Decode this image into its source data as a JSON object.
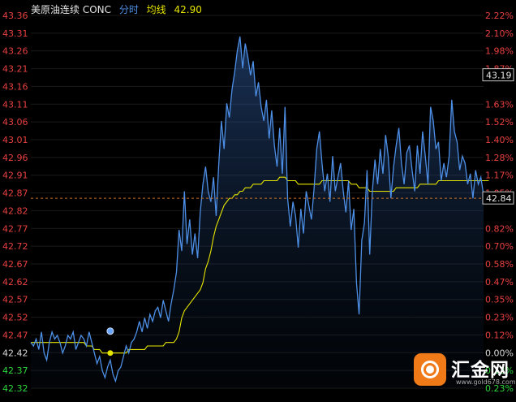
{
  "header": {
    "name": "美原油连续 CONC",
    "mode": "分时",
    "avg_label": "均线",
    "price": "42.90"
  },
  "logo": {
    "text": "汇金网",
    "url": "www.gold678.com"
  },
  "colors": {
    "background": "#000000",
    "price_line": "#4d8fe6",
    "avg_line": "#e6e600",
    "up": "#e84040",
    "down": "#2dd63c",
    "prev_close_line": "#d07020"
  },
  "chart_data": {
    "type": "line",
    "ylim": [
      42.3,
      43.36
    ],
    "prev_close": 42.42,
    "y_ticks_left": [
      "43.36",
      "43.31",
      "43.26",
      "43.21",
      "43.16",
      "43.11",
      "43.06",
      "43.01",
      "42.96",
      "42.91",
      "42.87",
      "42.82",
      "42.77",
      "42.72",
      "42.67",
      "42.62",
      "42.57",
      "42.52",
      "42.47",
      "42.42",
      "42.37",
      "42.32"
    ],
    "y_ticks_right": [
      "2.22%",
      "2.10%",
      "1.98%",
      "1.87%",
      "",
      "1.63%",
      "1.52%",
      "1.40%",
      "1.28%",
      "1.17%",
      "1.05%",
      "",
      "0.82%",
      "0.70%",
      "0.58%",
      "0.47%",
      "0.35%",
      "0.23%",
      "0.12%",
      "0.00%",
      "0.12%",
      "0.23%"
    ],
    "right_markers": [
      {
        "value": 43.19,
        "label": "43.19"
      },
      {
        "value": 42.84,
        "label": "42.84"
      }
    ],
    "dashed_reference": 42.84,
    "current_marker": {
      "value": 42.43,
      "index": 30
    },
    "series": [
      {
        "kind": "price",
        "values": [
          42.43,
          42.42,
          42.44,
          42.41,
          42.46,
          42.4,
          42.38,
          42.43,
          42.46,
          42.44,
          42.45,
          42.43,
          42.4,
          42.42,
          42.45,
          42.44,
          42.46,
          42.41,
          42.43,
          42.45,
          42.44,
          42.42,
          42.46,
          42.43,
          42.4,
          42.37,
          42.39,
          42.35,
          42.33,
          42.36,
          42.38,
          42.34,
          42.32,
          42.35,
          42.36,
          42.39,
          42.42,
          42.4,
          42.43,
          42.44,
          42.46,
          42.49,
          42.46,
          42.5,
          42.47,
          42.51,
          42.49,
          42.52,
          42.53,
          42.5,
          42.55,
          42.52,
          42.49,
          42.54,
          42.58,
          42.63,
          42.75,
          42.69,
          42.86,
          42.71,
          42.78,
          42.68,
          42.74,
          42.67,
          42.8,
          42.88,
          42.93,
          42.86,
          42.83,
          42.9,
          42.79,
          42.94,
          43.06,
          42.98,
          43.11,
          43.07,
          43.15,
          43.2,
          43.26,
          43.3,
          43.21,
          43.28,
          43.24,
          43.19,
          43.23,
          43.13,
          43.17,
          43.1,
          43.06,
          43.12,
          43.01,
          43.09,
          42.99,
          42.93,
          43.04,
          42.91,
          43.1,
          42.84,
          42.76,
          42.83,
          42.79,
          42.7,
          42.81,
          42.74,
          42.86,
          42.82,
          42.78,
          42.87,
          42.98,
          43.03,
          42.94,
          42.86,
          42.91,
          42.83,
          42.96,
          42.86,
          42.9,
          42.94,
          42.86,
          42.8,
          42.89,
          42.75,
          42.81,
          42.6,
          42.51,
          42.72,
          42.77,
          42.92,
          42.68,
          42.86,
          42.95,
          42.88,
          42.98,
          42.91,
          43.02,
          42.96,
          42.84,
          42.93,
          42.99,
          43.04,
          42.94,
          42.88,
          42.97,
          42.99,
          42.92,
          42.86,
          42.99,
          42.91,
          43.03,
          42.96,
          42.88,
          43.1,
          43.06,
          42.98,
          43.0,
          42.89,
          42.94,
          42.9,
          42.96,
          43.12,
          43.03,
          43.0,
          42.92,
          42.96,
          42.94,
          42.88,
          42.91,
          42.84,
          42.92,
          42.88,
          42.9,
          42.85
        ]
      },
      {
        "kind": "average",
        "values": [
          42.43,
          42.43,
          42.43,
          42.43,
          42.43,
          42.43,
          42.43,
          42.43,
          42.43,
          42.43,
          42.43,
          42.43,
          42.43,
          42.43,
          42.43,
          42.43,
          42.43,
          42.43,
          42.43,
          42.43,
          42.43,
          42.42,
          42.42,
          42.42,
          42.41,
          42.41,
          42.41,
          42.4,
          42.4,
          42.4,
          42.4,
          42.4,
          42.4,
          42.4,
          42.4,
          42.4,
          42.4,
          42.41,
          42.41,
          42.41,
          42.41,
          42.41,
          42.41,
          42.41,
          42.42,
          42.42,
          42.42,
          42.42,
          42.42,
          42.42,
          42.42,
          42.43,
          42.43,
          42.43,
          42.43,
          42.44,
          42.46,
          42.5,
          42.52,
          42.53,
          42.54,
          42.55,
          42.56,
          42.57,
          42.58,
          42.6,
          42.64,
          42.66,
          42.69,
          42.73,
          42.76,
          42.78,
          42.8,
          42.82,
          42.83,
          42.84,
          42.84,
          42.85,
          42.85,
          42.86,
          42.86,
          42.87,
          42.87,
          42.87,
          42.88,
          42.88,
          42.88,
          42.88,
          42.89,
          42.89,
          42.89,
          42.89,
          42.89,
          42.89,
          42.9,
          42.9,
          42.9,
          42.89,
          42.89,
          42.89,
          42.89,
          42.88,
          42.88,
          42.88,
          42.88,
          42.88,
          42.88,
          42.88,
          42.88,
          42.88,
          42.89,
          42.89,
          42.89,
          42.89,
          42.89,
          42.89,
          42.89,
          42.89,
          42.89,
          42.89,
          42.89,
          42.88,
          42.88,
          42.88,
          42.87,
          42.87,
          42.87,
          42.87,
          42.86,
          42.86,
          42.86,
          42.86,
          42.86,
          42.86,
          42.86,
          42.86,
          42.86,
          42.86,
          42.87,
          42.87,
          42.87,
          42.87,
          42.87,
          42.87,
          42.87,
          42.87,
          42.87,
          42.88,
          42.88,
          42.88,
          42.88,
          42.88,
          42.88,
          42.88,
          42.89,
          42.89,
          42.89,
          42.89,
          42.89,
          42.89,
          42.89,
          42.89,
          42.89,
          42.89,
          42.89,
          42.89,
          42.89,
          42.89,
          42.89,
          42.89,
          42.89,
          42.89,
          42.89,
          42.89
        ]
      }
    ]
  }
}
